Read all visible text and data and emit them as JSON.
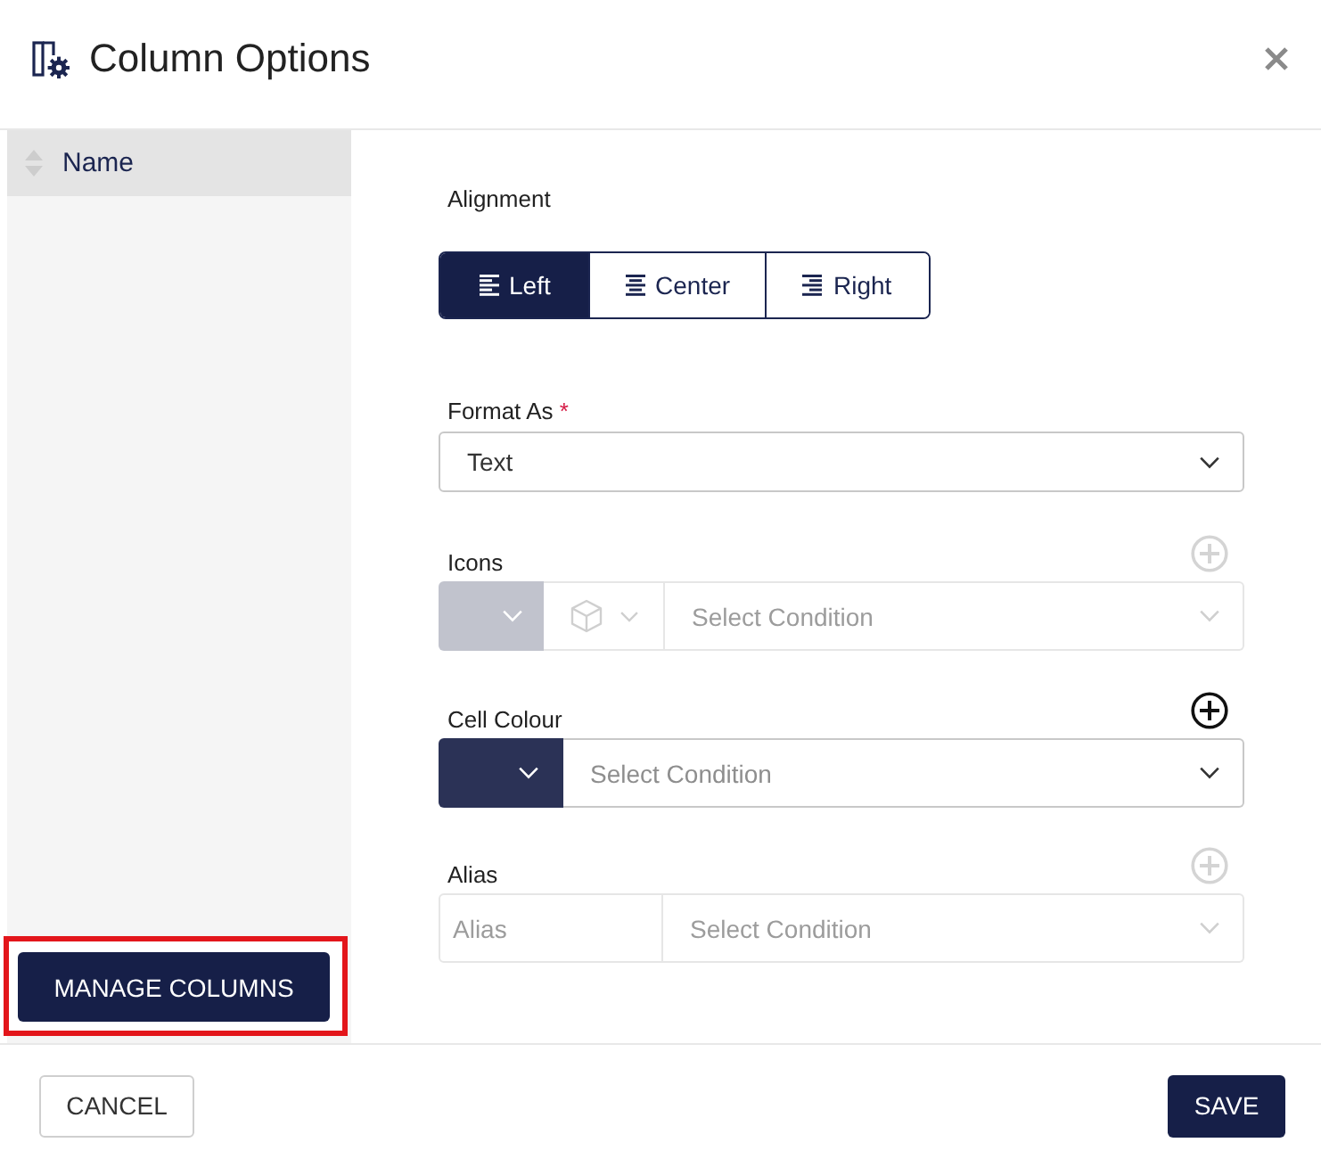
{
  "dialog": {
    "title": "Column Options"
  },
  "sidebar": {
    "items": [
      {
        "label": "Name",
        "selected": true
      }
    ],
    "manage_button": {
      "label": "MANAGE COLUMNS",
      "highlighted": true
    }
  },
  "alignment": {
    "label": "Alignment",
    "options": [
      {
        "kind": "left",
        "label": "Left",
        "selected": true
      },
      {
        "kind": "center",
        "label": "Center",
        "selected": false
      },
      {
        "kind": "right",
        "label": "Right",
        "selected": false
      }
    ]
  },
  "format_as": {
    "label": "Format As",
    "required_mark": "*",
    "value": "Text"
  },
  "rules": [
    {
      "kind": "icon",
      "label": "Icons",
      "disabled": true,
      "color": "#c1c3cd",
      "condition_placeholder": "Select Condition"
    },
    {
      "kind": "colour",
      "label": "Cell Colour",
      "disabled": false,
      "color": "#2b3256",
      "condition_placeholder": "Select Condition"
    },
    {
      "kind": "alias",
      "label": "Alias",
      "disabled": true,
      "alias_placeholder": "Alias",
      "condition_placeholder": "Select Condition"
    }
  ],
  "footer": {
    "buttons": [
      {
        "kind": "secondary",
        "label": "CANCEL"
      },
      {
        "kind": "primary",
        "label": "SAVE"
      }
    ]
  }
}
